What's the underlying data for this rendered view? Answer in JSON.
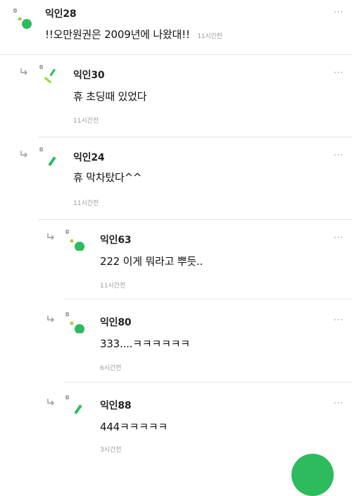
{
  "icons": {
    "reply": "reply-arrow-icon",
    "more": "more-horizontal-icon",
    "avatar": "avatar-shapes-icon"
  },
  "colors": {
    "accent_green": "#2dbb5d",
    "light_green": "#9bd43b",
    "muted_text": "#9a9a9a",
    "divider": "#e6e6e6"
  },
  "comments": [
    {
      "author": "익인28",
      "text": "!!오만원권은 2009년에 나왔대!!",
      "time": "11시간전",
      "more": "···"
    },
    {
      "author": "익인30",
      "text": "휴 초딩때 있었다",
      "time": "11시간전",
      "more": "···"
    },
    {
      "author": "익인24",
      "text": "휴 막차탔다^^",
      "time": "11시간전",
      "more": "···"
    },
    {
      "author": "익인63",
      "text": "222 이게 뭐라고 뿌듯..",
      "time": "11시간전",
      "more": "···"
    },
    {
      "author": "익인80",
      "text": "333....ㅋㅋㅋㅋㅋㅋ",
      "time": "6시간전",
      "more": "···"
    },
    {
      "author": "익인88",
      "text": "444ㅋㅋㅋㅋㅋ",
      "time": "3시간전",
      "more": "···"
    }
  ]
}
